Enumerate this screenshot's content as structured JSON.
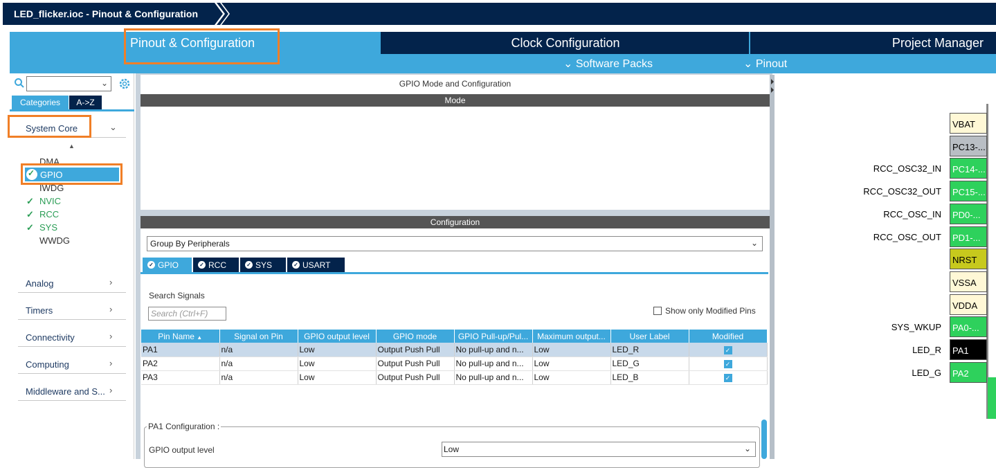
{
  "breadcrumb": {
    "title": "LED_flicker.ioc - Pinout & Configuration"
  },
  "tabs": {
    "pinout": "Pinout & Configuration",
    "clock": "Clock Configuration",
    "project": "Project Manager"
  },
  "subtabs": {
    "software_packs": "Software Packs",
    "pinout": "Pinout"
  },
  "left": {
    "cat_tab": "Categories",
    "az_tab": "A->Z",
    "system_core": "System Core",
    "system_items": [
      {
        "label": "DMA",
        "enabled": false
      },
      {
        "label": "GPIO",
        "enabled": true,
        "selected": true
      },
      {
        "label": "IWDG",
        "enabled": false
      },
      {
        "label": "NVIC",
        "enabled": true
      },
      {
        "label": "RCC",
        "enabled": true
      },
      {
        "label": "SYS",
        "enabled": true
      },
      {
        "label": "WWDG",
        "enabled": false
      }
    ],
    "categories": [
      "Analog",
      "Timers",
      "Connectivity",
      "Computing",
      "Middleware and S..."
    ]
  },
  "center": {
    "title": "GPIO Mode and Configuration",
    "mode_bar": "Mode",
    "config_bar": "Configuration",
    "group_by": "Group By Peripherals",
    "peripheral_tabs": [
      "GPIO",
      "RCC",
      "SYS",
      "USART"
    ],
    "search_label": "Search Signals",
    "search_placeholder": "Search (Ctrl+F)",
    "show_modified": "Show only Modified Pins",
    "columns": [
      "Pin Name",
      "Signal on Pin",
      "GPIO output level",
      "GPIO mode",
      "GPIO Pull-up/Pul...",
      "Maximum output...",
      "User Label",
      "Modified"
    ],
    "rows": [
      {
        "pin": "PA1",
        "signal": "n/a",
        "level": "Low",
        "mode": "Output Push Pull",
        "pull": "No pull-up and n...",
        "speed": "Low",
        "label": "LED_R",
        "modified": true
      },
      {
        "pin": "PA2",
        "signal": "n/a",
        "level": "Low",
        "mode": "Output Push Pull",
        "pull": "No pull-up and n...",
        "speed": "Low",
        "label": "LED_G",
        "modified": true
      },
      {
        "pin": "PA3",
        "signal": "n/a",
        "level": "Low",
        "mode": "Output Push Pull",
        "pull": "No pull-up and n...",
        "speed": "Low",
        "label": "LED_B",
        "modified": true
      }
    ],
    "pa1_title": "PA1 Configuration :",
    "gpio_out_label": "GPIO output level",
    "gpio_out_value": "Low"
  },
  "chip": {
    "pins": [
      {
        "name": "VBAT",
        "label": "",
        "color": "y"
      },
      {
        "name": "PC13-...",
        "label": "",
        "color": "gr"
      },
      {
        "name": "PC14-...",
        "label": "RCC_OSC32_IN",
        "color": "g"
      },
      {
        "name": "PC15-...",
        "label": "RCC_OSC32_OUT",
        "color": "g"
      },
      {
        "name": "PD0-...",
        "label": "RCC_OSC_IN",
        "color": "g"
      },
      {
        "name": "PD1-...",
        "label": "RCC_OSC_OUT",
        "color": "g"
      },
      {
        "name": "NRST",
        "label": "",
        "color": "ol"
      },
      {
        "name": "VSSA",
        "label": "",
        "color": "y"
      },
      {
        "name": "VDDA",
        "label": "",
        "color": "y"
      },
      {
        "name": "PA0-...",
        "label": "SYS_WKUP",
        "color": "g"
      },
      {
        "name": "PA1",
        "label": "LED_R",
        "color": "bk"
      },
      {
        "name": "PA2",
        "label": "LED_G",
        "color": "g"
      }
    ]
  }
}
